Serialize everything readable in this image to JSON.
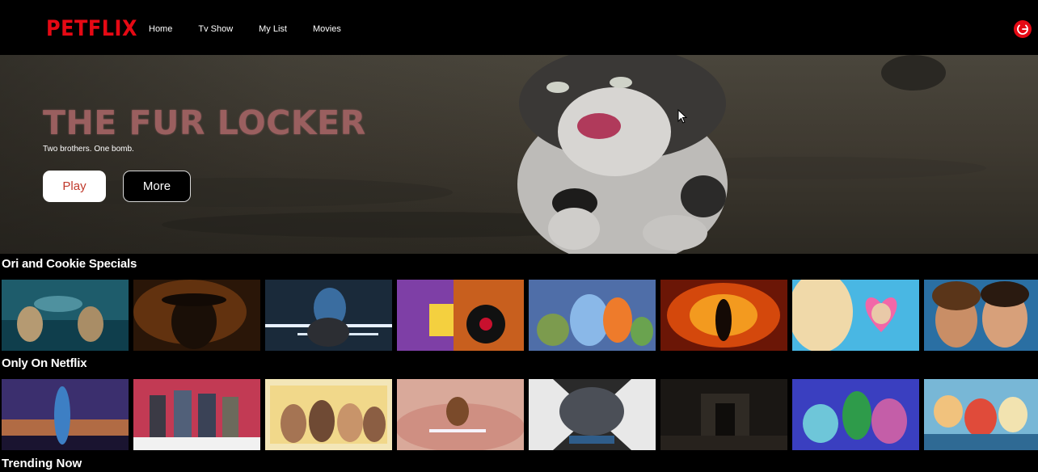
{
  "brand": {
    "logo_text": "PETFLIX",
    "accent_color": "#e50914"
  },
  "nav": {
    "items": [
      {
        "label": "Home"
      },
      {
        "label": "Tv Show"
      },
      {
        "label": "My List"
      },
      {
        "label": "Movies"
      }
    ],
    "profile_icon": "power-icon"
  },
  "hero": {
    "title": "THE FUR LOCKER",
    "tagline": "Two brothers. One bomb.",
    "play_label": "Play",
    "more_label": "More"
  },
  "rows": [
    {
      "title": "Ori and Cookie Specials",
      "cards": [
        {
          "art": "underwater-heroes-poster-icon"
        },
        {
          "art": "adventurer-fedora-poster-icon"
        },
        {
          "art": "lightsaber-warrior-poster-icon"
        },
        {
          "art": "spider-hero-animated-poster-icon"
        },
        {
          "art": "elemental-characters-poster-icon"
        },
        {
          "art": "explosion-silhouette-poster-icon"
        },
        {
          "art": "pink-mirror-doll-poster-icon"
        },
        {
          "art": "couple-closeup-poster-icon"
        }
      ]
    },
    {
      "title": "Only On Netflix",
      "cards": [
        {
          "art": "blue-armored-hero-poster-icon"
        },
        {
          "art": "super-team-group-poster-icon"
        },
        {
          "art": "cast-group-comedy-poster-icon"
        },
        {
          "art": "rocket-raccoon-sky-poster-icon"
        },
        {
          "art": "x-car-race-poster-icon"
        },
        {
          "art": "dark-hallway-poster-icon"
        },
        {
          "art": "animated-monsters-poster-icon"
        },
        {
          "art": "pirate-crew-anime-poster-icon"
        }
      ]
    },
    {
      "title": "Trending Now",
      "cards": []
    }
  ]
}
